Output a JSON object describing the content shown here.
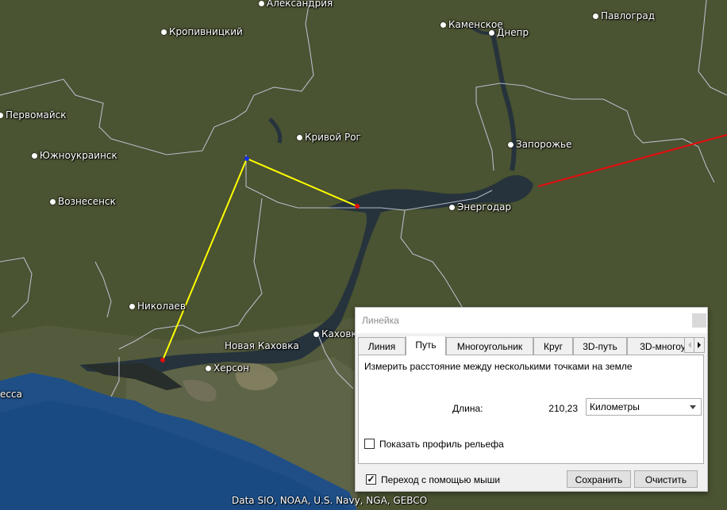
{
  "map": {
    "cities": [
      {
        "id": "aleksandriya",
        "name": "Александрия"
      },
      {
        "id": "pavlograd",
        "name": "Павлоград"
      },
      {
        "id": "kropivnitsky",
        "name": "Кропивницкий"
      },
      {
        "id": "kamenskoe",
        "name": "Каменское"
      },
      {
        "id": "dnepr",
        "name": "Днепр"
      },
      {
        "id": "pervomaysk",
        "name": "Первомайск"
      },
      {
        "id": "krivoy-rog",
        "name": "Кривой Рог"
      },
      {
        "id": "yuzhnoukrainsk",
        "name": "Южноукраинск"
      },
      {
        "id": "zaporozhye",
        "name": "Запорожье"
      },
      {
        "id": "voznesensk",
        "name": "Вознесенск"
      },
      {
        "id": "energodar",
        "name": "Энергодар"
      },
      {
        "id": "nikolaev",
        "name": "Николаев"
      },
      {
        "id": "kakhovka",
        "name": "Каховк"
      },
      {
        "id": "nova-kakhovka",
        "name": "Новая Каховка"
      },
      {
        "id": "kherson",
        "name": "Херсон"
      },
      {
        "id": "odessa",
        "name": "есса"
      }
    ],
    "attribution": "Data SIO, NOAA, U.S. Navy, NGA, GEBCO",
    "colors": {
      "path_line": "#ffff00",
      "other_line": "#e01010",
      "border_line": "#c8cfe0",
      "water": "#24343f",
      "land": "#4a5236"
    }
  },
  "ruler": {
    "title": "Линейка",
    "tabs": [
      "Линия",
      "Путь",
      "Многоугольник",
      "Круг",
      "3D-путь",
      "3D-многоу"
    ],
    "active_tab": "Путь",
    "description": "Измерить расстояние между несколькими точками на земле",
    "length_label": "Длина:",
    "length_value": "210,23",
    "unit": "Километры",
    "show_profile_label": "Показать профиль рельефа",
    "show_profile_checked": false,
    "mouse_nav_label": "Переход с помощью мыши",
    "mouse_nav_checked": true,
    "save_label": "Сохранить",
    "clear_label": "Очистить"
  }
}
